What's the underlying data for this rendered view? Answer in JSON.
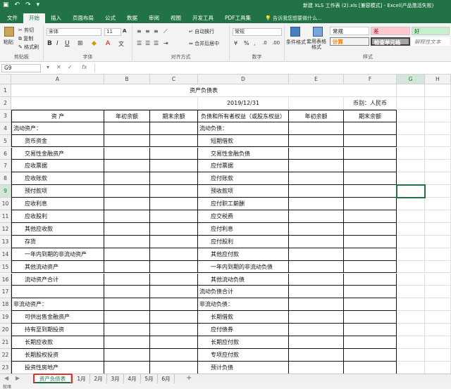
{
  "titlebar": {
    "title": "新建 XLS 工作表 (2).xls  [兼容模式]  -  Excel(产品激活失败)"
  },
  "tabs": [
    "文件",
    "开始",
    "插入",
    "页面布局",
    "公式",
    "数据",
    "审阅",
    "视图",
    "开发工具",
    "PDF工具集"
  ],
  "active_tab": "开始",
  "tellme": "告诉我您想要做什么...",
  "ribbon": {
    "clipboard": {
      "paste": "粘贴",
      "cut": "剪切",
      "copy": "复制",
      "format_painter": "格式刷",
      "label": "剪贴板"
    },
    "font": {
      "name": "宋体",
      "size": "11",
      "label": "字体"
    },
    "alignment": {
      "wrap": "自动换行",
      "merge": "合并后居中",
      "label": "对齐方式"
    },
    "number": {
      "format": "常规",
      "label": "数字"
    },
    "styles": {
      "cond": "条件格式",
      "table": "套用表格格式",
      "normal": "常规",
      "bad": "差",
      "good": "好",
      "calc": "计算",
      "check": "检查单元格",
      "explain": "解释性文本",
      "label": "样式"
    }
  },
  "formula_bar": {
    "name_box": "G9",
    "fx": "fx",
    "value": ""
  },
  "columns": [
    "A",
    "B",
    "C",
    "D",
    "E",
    "F",
    "G",
    "H"
  ],
  "rows": [
    "1",
    "2",
    "3",
    "4",
    "5",
    "6",
    "7",
    "8",
    "9",
    "10",
    "11",
    "12",
    "13",
    "14",
    "15",
    "16",
    "17",
    "18",
    "19",
    "20",
    "21",
    "22",
    "23"
  ],
  "sheet": {
    "title": "资产负债表",
    "date": "2019/12/31",
    "currency": "币别：人民币",
    "headers": {
      "asset": "资          产",
      "begin": "年初余额",
      "end": "期末余额",
      "liability": "负债和所有者权益（或股东权益）",
      "begin2": "年初余额",
      "end2": "期末余额"
    },
    "assets": [
      "流动资产：",
      "货币资金",
      "交易性金融资产",
      "应收票据",
      "应收账款",
      "预付款项",
      "应收利息",
      "应收股利",
      "其他应收款",
      "存货",
      "一年内到期的非流动资产",
      "其他流动资产",
      "流动资产合计",
      "",
      "非流动资产：",
      "可供出售金融资产",
      "持有至到期投资",
      "长期应收款",
      "长期股权投资",
      "投资性房地产"
    ],
    "liabilities": [
      "流动负债：",
      "短期借款",
      "交易性金融负债",
      "应付票据",
      "应付账款",
      "预收款项",
      "应付职工薪酬",
      "应交税费",
      "应付利息",
      "应付股利",
      "其他应付款",
      "一年内到期的非流动负债",
      "其他流动负债",
      "流动负债合计",
      "非流动负债：",
      "长期借款",
      "应付债券",
      "长期应付款",
      "专项应付款",
      "预计负债"
    ]
  },
  "sheet_tabs": [
    "资产负债表",
    "1月",
    "2月",
    "3月",
    "4月",
    "5月",
    "6月"
  ],
  "active_sheet": "资产负债表",
  "add_sheet": "+",
  "status": "就绪"
}
